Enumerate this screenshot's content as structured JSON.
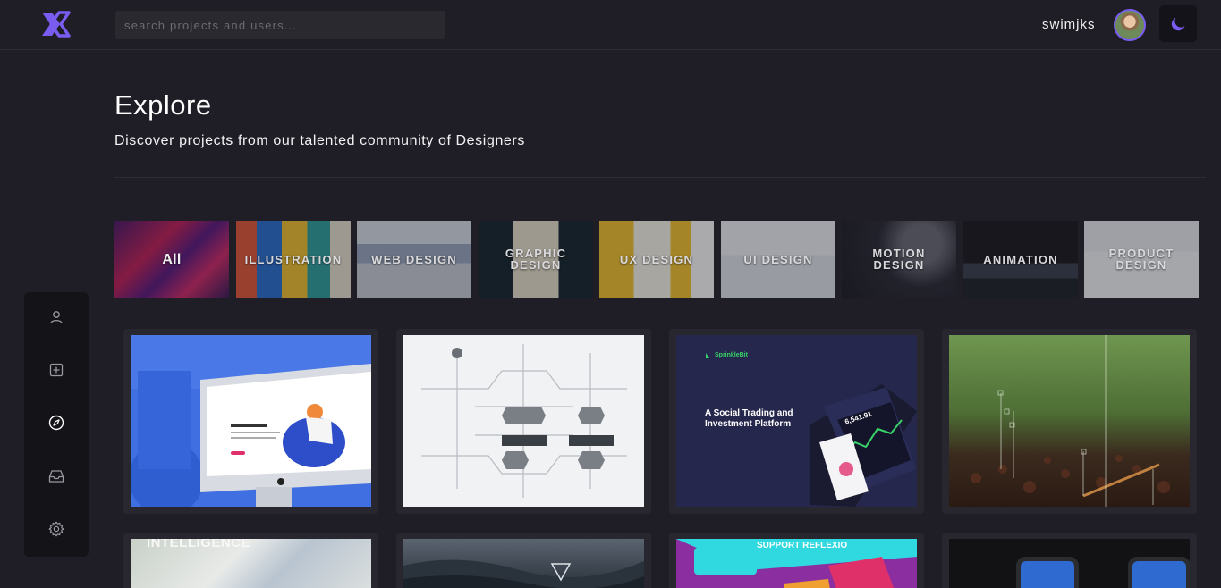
{
  "header": {
    "search_placeholder": "search projects and users...",
    "username": "swimjks"
  },
  "page": {
    "title": "Explore",
    "subtitle": "Discover projects from our talented community of Designers"
  },
  "categories": [
    {
      "label": "All"
    },
    {
      "label": "ILLUSTRATION"
    },
    {
      "label": "WEB DESIGN"
    },
    {
      "label": "GRAPHIC DESIGN"
    },
    {
      "label": "UX DESIGN"
    },
    {
      "label": "UI DESIGN"
    },
    {
      "label": "MOTION DESIGN"
    },
    {
      "label": "ANIMATION"
    },
    {
      "label": "PRODUCT DESIGN"
    }
  ],
  "projects": {
    "card3": {
      "brand": "SprinkleBit",
      "headline": "A Social Trading and Investment Platform",
      "price": "6,541.91"
    },
    "card5": {
      "headline": "INTELLIGENCE"
    },
    "card7": {
      "headline": "SUPPORT REFLEXIO"
    }
  },
  "colors": {
    "background": "#1f1e27",
    "sidebar": "#141318",
    "accent": "#7a5cf0",
    "card": "#28272f"
  },
  "icons": {
    "logo": "brand-logo-icon",
    "theme": "moon-icon",
    "nav": [
      "user-icon",
      "plus-square-icon",
      "compass-icon",
      "inbox-icon",
      "gear-icon"
    ]
  }
}
